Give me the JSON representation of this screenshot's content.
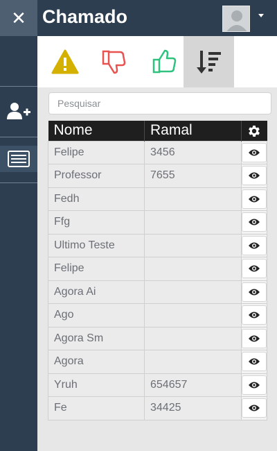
{
  "header": {
    "title": "Chamado",
    "close_icon": "close-icon",
    "avatar_icon": "user-avatar",
    "caret_icon": "caret-down-icon"
  },
  "sidebar": {
    "items": [
      {
        "icon": "add-user-icon"
      },
      {
        "icon": "list-card-icon"
      }
    ]
  },
  "toolbar": {
    "tools": [
      {
        "icon": "warning-icon",
        "color": "#d4b000"
      },
      {
        "icon": "thumbs-down-icon",
        "color": "#e8524f"
      },
      {
        "icon": "thumbs-up-icon",
        "color": "#2ec27e"
      },
      {
        "icon": "sort-descending-icon",
        "color": "#333333",
        "active": true
      }
    ]
  },
  "search": {
    "placeholder": "Pesquisar",
    "value": ""
  },
  "table": {
    "columns": {
      "name": "Nome",
      "extension": "Ramal",
      "settings_icon": "gear-icon"
    },
    "rows": [
      {
        "name": "Felipe",
        "extension": "3456"
      },
      {
        "name": "Professor",
        "extension": "7655"
      },
      {
        "name": "Fedh",
        "extension": ""
      },
      {
        "name": "Ffg",
        "extension": ""
      },
      {
        "name": "Ultimo Teste",
        "extension": ""
      },
      {
        "name": "Felipe",
        "extension": ""
      },
      {
        "name": "Agora Ai",
        "extension": ""
      },
      {
        "name": "Ago",
        "extension": ""
      },
      {
        "name": "Agora Sm",
        "extension": ""
      },
      {
        "name": "Agora",
        "extension": ""
      },
      {
        "name": "Yruh",
        "extension": "654657"
      },
      {
        "name": "Fe",
        "extension": "34425"
      }
    ],
    "row_action_icon": "eye-icon"
  },
  "colors": {
    "dark_navy": "#2d3e50",
    "header_table": "#1f1f1f",
    "active_tool": "#d6d6d6"
  }
}
